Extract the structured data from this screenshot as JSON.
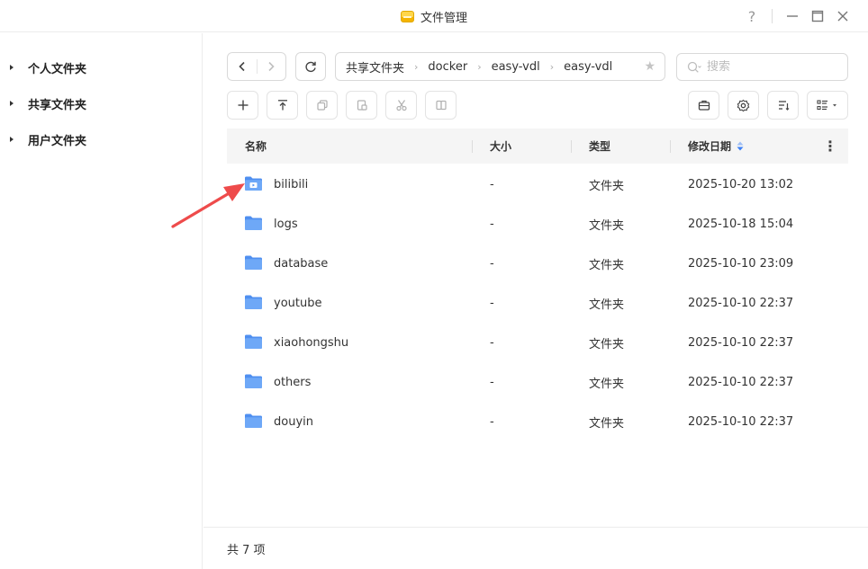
{
  "window": {
    "title": "文件管理",
    "help_label": "?"
  },
  "sidebar": {
    "items": [
      {
        "label": "个人文件夹"
      },
      {
        "label": "共享文件夹"
      },
      {
        "label": "用户文件夹"
      }
    ]
  },
  "breadcrumb": {
    "items": [
      "共享文件夹",
      "docker",
      "easy-vdl",
      "easy-vdl"
    ]
  },
  "search": {
    "placeholder": "搜索"
  },
  "table": {
    "columns": {
      "name": "名称",
      "size": "大小",
      "type": "类型",
      "modified": "修改日期"
    },
    "sort_column": "modified",
    "rows": [
      {
        "name": "bilibili",
        "size": "-",
        "type": "文件夹",
        "modified": "2025-10-20 13:02",
        "icon": "video-folder-icon"
      },
      {
        "name": "logs",
        "size": "-",
        "type": "文件夹",
        "modified": "2025-10-18 15:04",
        "icon": "folder-icon"
      },
      {
        "name": "database",
        "size": "-",
        "type": "文件夹",
        "modified": "2025-10-10 23:09",
        "icon": "folder-icon"
      },
      {
        "name": "youtube",
        "size": "-",
        "type": "文件夹",
        "modified": "2025-10-10 22:37",
        "icon": "folder-icon"
      },
      {
        "name": "xiaohongshu",
        "size": "-",
        "type": "文件夹",
        "modified": "2025-10-10 22:37",
        "icon": "folder-icon"
      },
      {
        "name": "others",
        "size": "-",
        "type": "文件夹",
        "modified": "2025-10-10 22:37",
        "icon": "folder-icon"
      },
      {
        "name": "douyin",
        "size": "-",
        "type": "文件夹",
        "modified": "2025-10-10 22:37",
        "icon": "folder-icon"
      }
    ]
  },
  "footer": {
    "count_label": "共 7 项"
  },
  "colors": {
    "folder": "#6ea8f7",
    "folder_dark": "#4f8ff0",
    "sort_active": "#3b7ff5",
    "annotation_arrow": "#ee4b4b"
  }
}
